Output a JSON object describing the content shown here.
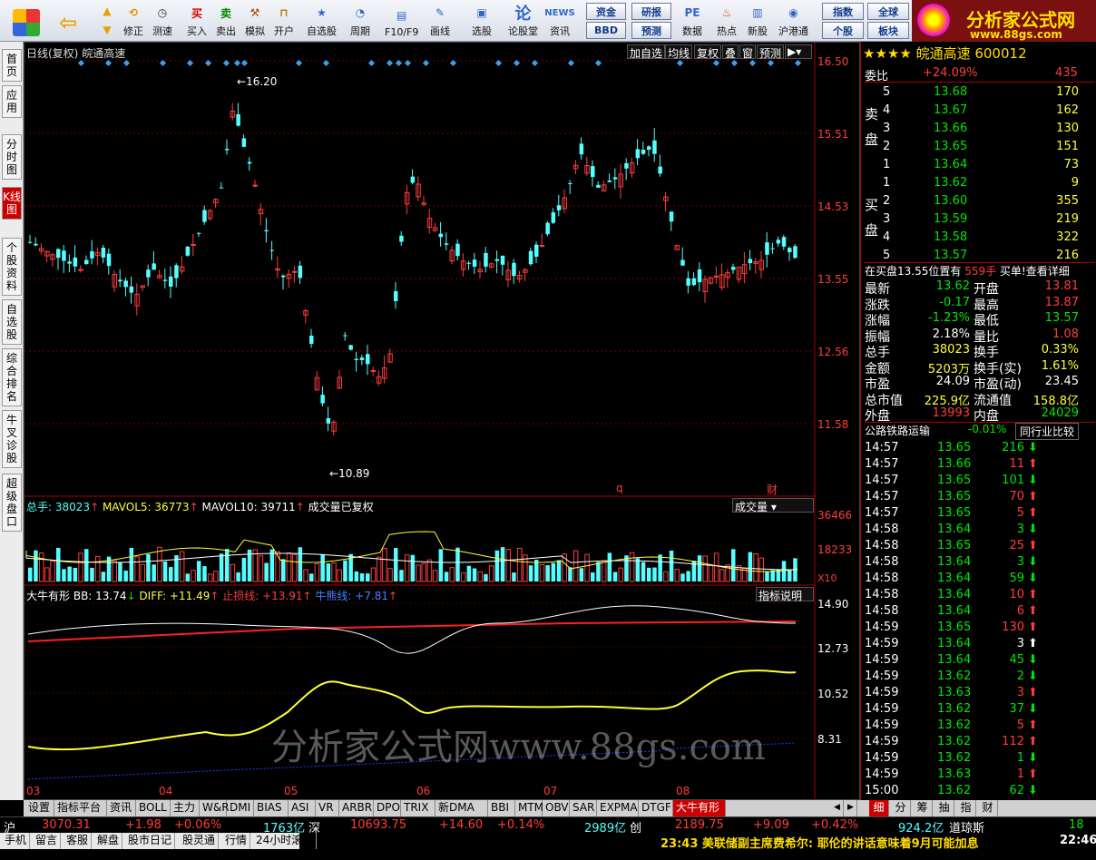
{
  "toolbar": {
    "buttons": [
      "",
      "",
      "修正",
      "测速",
      "买入",
      "卖出",
      "模拟",
      "开户",
      "自选股",
      "周期",
      "F10/F9",
      "画线",
      "选股",
      "论股堂",
      "资讯",
      "",
      "",
      "数据",
      "热点",
      "新股",
      "沪港通"
    ],
    "small_buttons": [
      "资金",
      "研报",
      "指数",
      "全球",
      "BBD",
      "预测",
      "个股",
      "板块"
    ],
    "logo_text": "分析家公式网",
    "logo_url": "www.88gs.com"
  },
  "sidenav": [
    "首页",
    "应用",
    "分时图",
    "K线图",
    "个股资料",
    "自选股",
    "综合排名",
    "牛叉诊股",
    "超级盘口"
  ],
  "kchart": {
    "title": "日线(复权)",
    "stock_name": "皖通高速",
    "buttons": [
      "加自选",
      "均线",
      "复权",
      "叠",
      "窗",
      "预测"
    ],
    "price_axis": [
      "16.50",
      "15.51",
      "14.53",
      "13.55",
      "12.56",
      "11.58"
    ],
    "high_label": "16.20",
    "low_label": "10.89",
    "marker_q": "q",
    "marker_cai": "财"
  },
  "volume": {
    "total_label": "总手:",
    "total": "38023",
    "mavol5_label": "MAVOL5:",
    "mavol5": "36773",
    "mavol10_label": "MAVOL10:",
    "mavol10": "39711",
    "note": "成交量已复权",
    "dropdown": "成交量",
    "axis": [
      "36466",
      "18233"
    ],
    "unit": "X10"
  },
  "indicator": {
    "name": "大牛有形",
    "bb": "BB: 13.74",
    "diff": "DIFF: +11.49",
    "stop": "止损线: +13.91",
    "bull": "牛熊线: +7.81",
    "explain": "指标说明",
    "axis": [
      "14.90",
      "12.73",
      "10.52",
      "8.31"
    ],
    "months": [
      "03",
      "04",
      "05",
      "06",
      "07",
      "08"
    ],
    "watermark": "分析家公式网www.88gs.com"
  },
  "tabs": [
    "设置",
    "指标平台",
    "资讯",
    "BOLL",
    "主力",
    "W&R",
    "DMI",
    "BIAS",
    "ASI",
    "VR",
    "ARBR",
    "DPO",
    "TRIX",
    "新DMA",
    "BBI",
    "MTM",
    "OBV",
    "SAR",
    "EXPMA",
    "DTGF",
    "大牛有形"
  ],
  "quote": {
    "header": "皖通高速 600012",
    "wb_label": "委比",
    "wb": "+24.09%",
    "wc": "435",
    "sell_label": "卖盘",
    "buy_label": "买盘",
    "sells": [
      [
        "5",
        "13.68",
        "170"
      ],
      [
        "4",
        "13.67",
        "162"
      ],
      [
        "3",
        "13.66",
        "130"
      ],
      [
        "2",
        "13.65",
        "151"
      ],
      [
        "1",
        "13.64",
        "73"
      ]
    ],
    "buys": [
      [
        "1",
        "13.62",
        "9"
      ],
      [
        "2",
        "13.60",
        "355"
      ],
      [
        "3",
        "13.59",
        "219"
      ],
      [
        "4",
        "13.58",
        "322"
      ],
      [
        "5",
        "13.57",
        "216"
      ]
    ],
    "inbuy": "在买盘13.55位置有",
    "inbuy_qty": "559手",
    "inbuy_tail": "买单!查看详细",
    "stats": [
      [
        "最新",
        "13.62",
        "开盘",
        "13.81"
      ],
      [
        "涨跌",
        "-0.17",
        "最高",
        "13.87"
      ],
      [
        "涨幅",
        "-1.23%",
        "最低",
        "13.57"
      ],
      [
        "振幅",
        "2.18%",
        "量比",
        "1.08"
      ],
      [
        "总手",
        "38023",
        "换手",
        "0.33%"
      ],
      [
        "金额",
        "5203万",
        "换手(实)",
        "1.61%"
      ],
      [
        "市盈",
        "24.09",
        "市盈(动)",
        "23.45"
      ],
      [
        "总市值",
        "225.9亿",
        "流通值",
        "158.8亿"
      ],
      [
        "外盘",
        "13993",
        "内盘",
        "24029"
      ]
    ],
    "sector": "公路铁路运输",
    "sector_pct": "-0.01%",
    "sector_btn": "同行业比较",
    "ticks": [
      [
        "14:57",
        "13.65",
        "216",
        "down"
      ],
      [
        "14:57",
        "13.66",
        "11",
        "up"
      ],
      [
        "14:57",
        "13.65",
        "101",
        "down"
      ],
      [
        "14:57",
        "13.65",
        "70",
        "up"
      ],
      [
        "14:57",
        "13.65",
        "5",
        "up"
      ],
      [
        "14:58",
        "13.64",
        "3",
        "down"
      ],
      [
        "14:58",
        "13.65",
        "25",
        "up"
      ],
      [
        "14:58",
        "13.64",
        "3",
        "down"
      ],
      [
        "14:58",
        "13.64",
        "59",
        "down"
      ],
      [
        "14:58",
        "13.64",
        "10",
        "up"
      ],
      [
        "14:58",
        "13.64",
        "6",
        "up"
      ],
      [
        "14:59",
        "13.65",
        "130",
        "up"
      ],
      [
        "14:59",
        "13.64",
        "3",
        "neutral"
      ],
      [
        "14:59",
        "13.64",
        "45",
        "down"
      ],
      [
        "14:59",
        "13.62",
        "2",
        "down"
      ],
      [
        "14:59",
        "13.63",
        "3",
        "up"
      ],
      [
        "14:59",
        "13.62",
        "37",
        "down"
      ],
      [
        "14:59",
        "13.62",
        "5",
        "up"
      ],
      [
        "14:59",
        "13.62",
        "112",
        "up"
      ],
      [
        "14:59",
        "13.62",
        "1",
        "down"
      ],
      [
        "14:59",
        "13.63",
        "1",
        "up"
      ],
      [
        "15:00",
        "13.62",
        "62",
        "down"
      ]
    ],
    "bottom_tabs": [
      "细",
      "分",
      "筹",
      "抽",
      "指",
      "财"
    ]
  },
  "status": {
    "sh": "沪",
    "sh_val": "3070.31",
    "sh_chg": "+1.98",
    "sh_pct": "+0.06%",
    "sh_amt": "1763亿",
    "sz": "深",
    "sz_val": "10693.75",
    "sz_chg": "+14.60",
    "sz_pct": "+0.14%",
    "sz_amt": "2989亿",
    "cy": "创",
    "cy_val": "2189.75",
    "cy_chg": "+9.09",
    "cy_pct": "+0.42%",
    "cy_amt": "924.2亿",
    "dj": "道琼斯",
    "dj_val": "18",
    "links": [
      "手机",
      "留言",
      "客服",
      "解盘",
      "股市日记",
      "股灵通",
      "行情",
      "24小时滚动"
    ],
    "news": "23:43 美联储副主席费希尔: 耶伦的讲话意味着9月可能加息",
    "clock": "22:46"
  }
}
